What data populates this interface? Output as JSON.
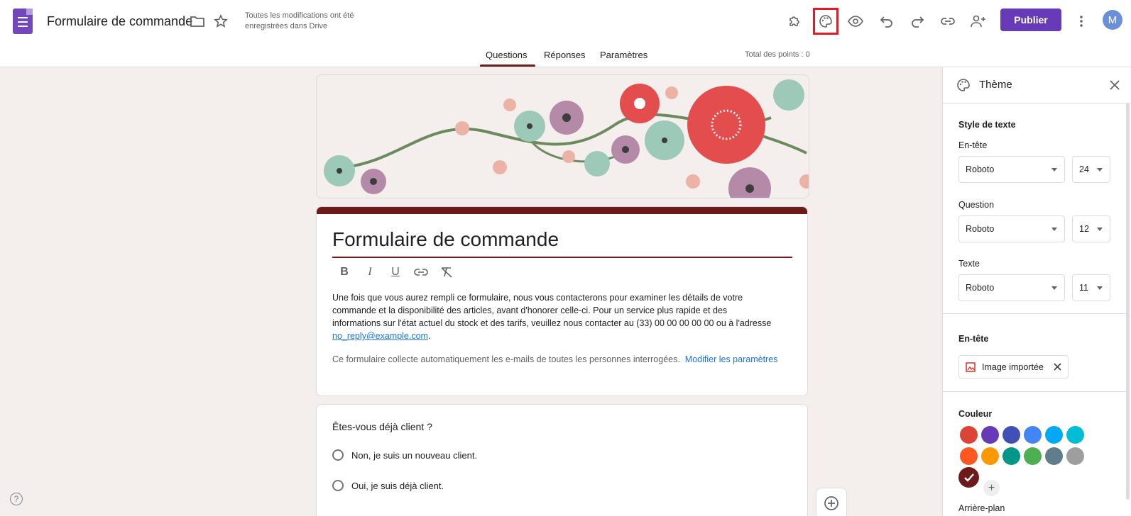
{
  "header": {
    "doc_title": "Formulaire de commande",
    "saved_status": "Toutes les modifications ont été enregistrées dans Drive",
    "publish_label": "Publier",
    "avatar_initial": "M"
  },
  "tabs": [
    {
      "label": "Questions",
      "active": true
    },
    {
      "label": "Réponses",
      "active": false
    },
    {
      "label": "Paramètres",
      "active": false
    }
  ],
  "total_points": "Total des points : 0",
  "form": {
    "title": "Formulaire de commande",
    "description_pre": "Une fois que vous aurez rempli ce formulaire, nous vous contacterons pour examiner les détails de votre commande et la disponibilité des articles, avant d'honorer celle-ci. Pour un service plus rapide et des informations sur l'état actuel du stock et des tarifs, veuillez nous contacter au (33) 00 00 00 00 00 ou à l'adresse ",
    "description_email": "no_reply@example.com",
    "description_post": ".",
    "collect_notice": "Ce formulaire collecte automatiquement les e-mails de toutes les personnes interrogées.",
    "collect_link": "Modifier les paramètres"
  },
  "question": {
    "title": "Êtes-vous déjà client ?",
    "options": [
      "Non, je suis un nouveau client.",
      "Oui, je suis déjà client."
    ]
  },
  "theme_panel": {
    "title": "Thème",
    "text_style_label": "Style de texte",
    "header_label": "En-tête",
    "header_font": "Roboto",
    "header_size": "24",
    "question_label": "Question",
    "question_font": "Roboto",
    "question_size": "12",
    "text_label": "Texte",
    "text_font": "Roboto",
    "text_size": "11",
    "header_section_label": "En-tête",
    "header_image_chip": "Image importée",
    "color_label": "Couleur",
    "background_label": "Arrière-plan",
    "colors": [
      "#db4437",
      "#673ab7",
      "#3f51b5",
      "#4285f4",
      "#03a9f4",
      "#00bcd4",
      "#ff5722",
      "#ff9800",
      "#009688",
      "#4caf50",
      "#607d8b",
      "#9e9e9e",
      "#6d1a1a"
    ],
    "selected_color": "#6d1a1a"
  }
}
